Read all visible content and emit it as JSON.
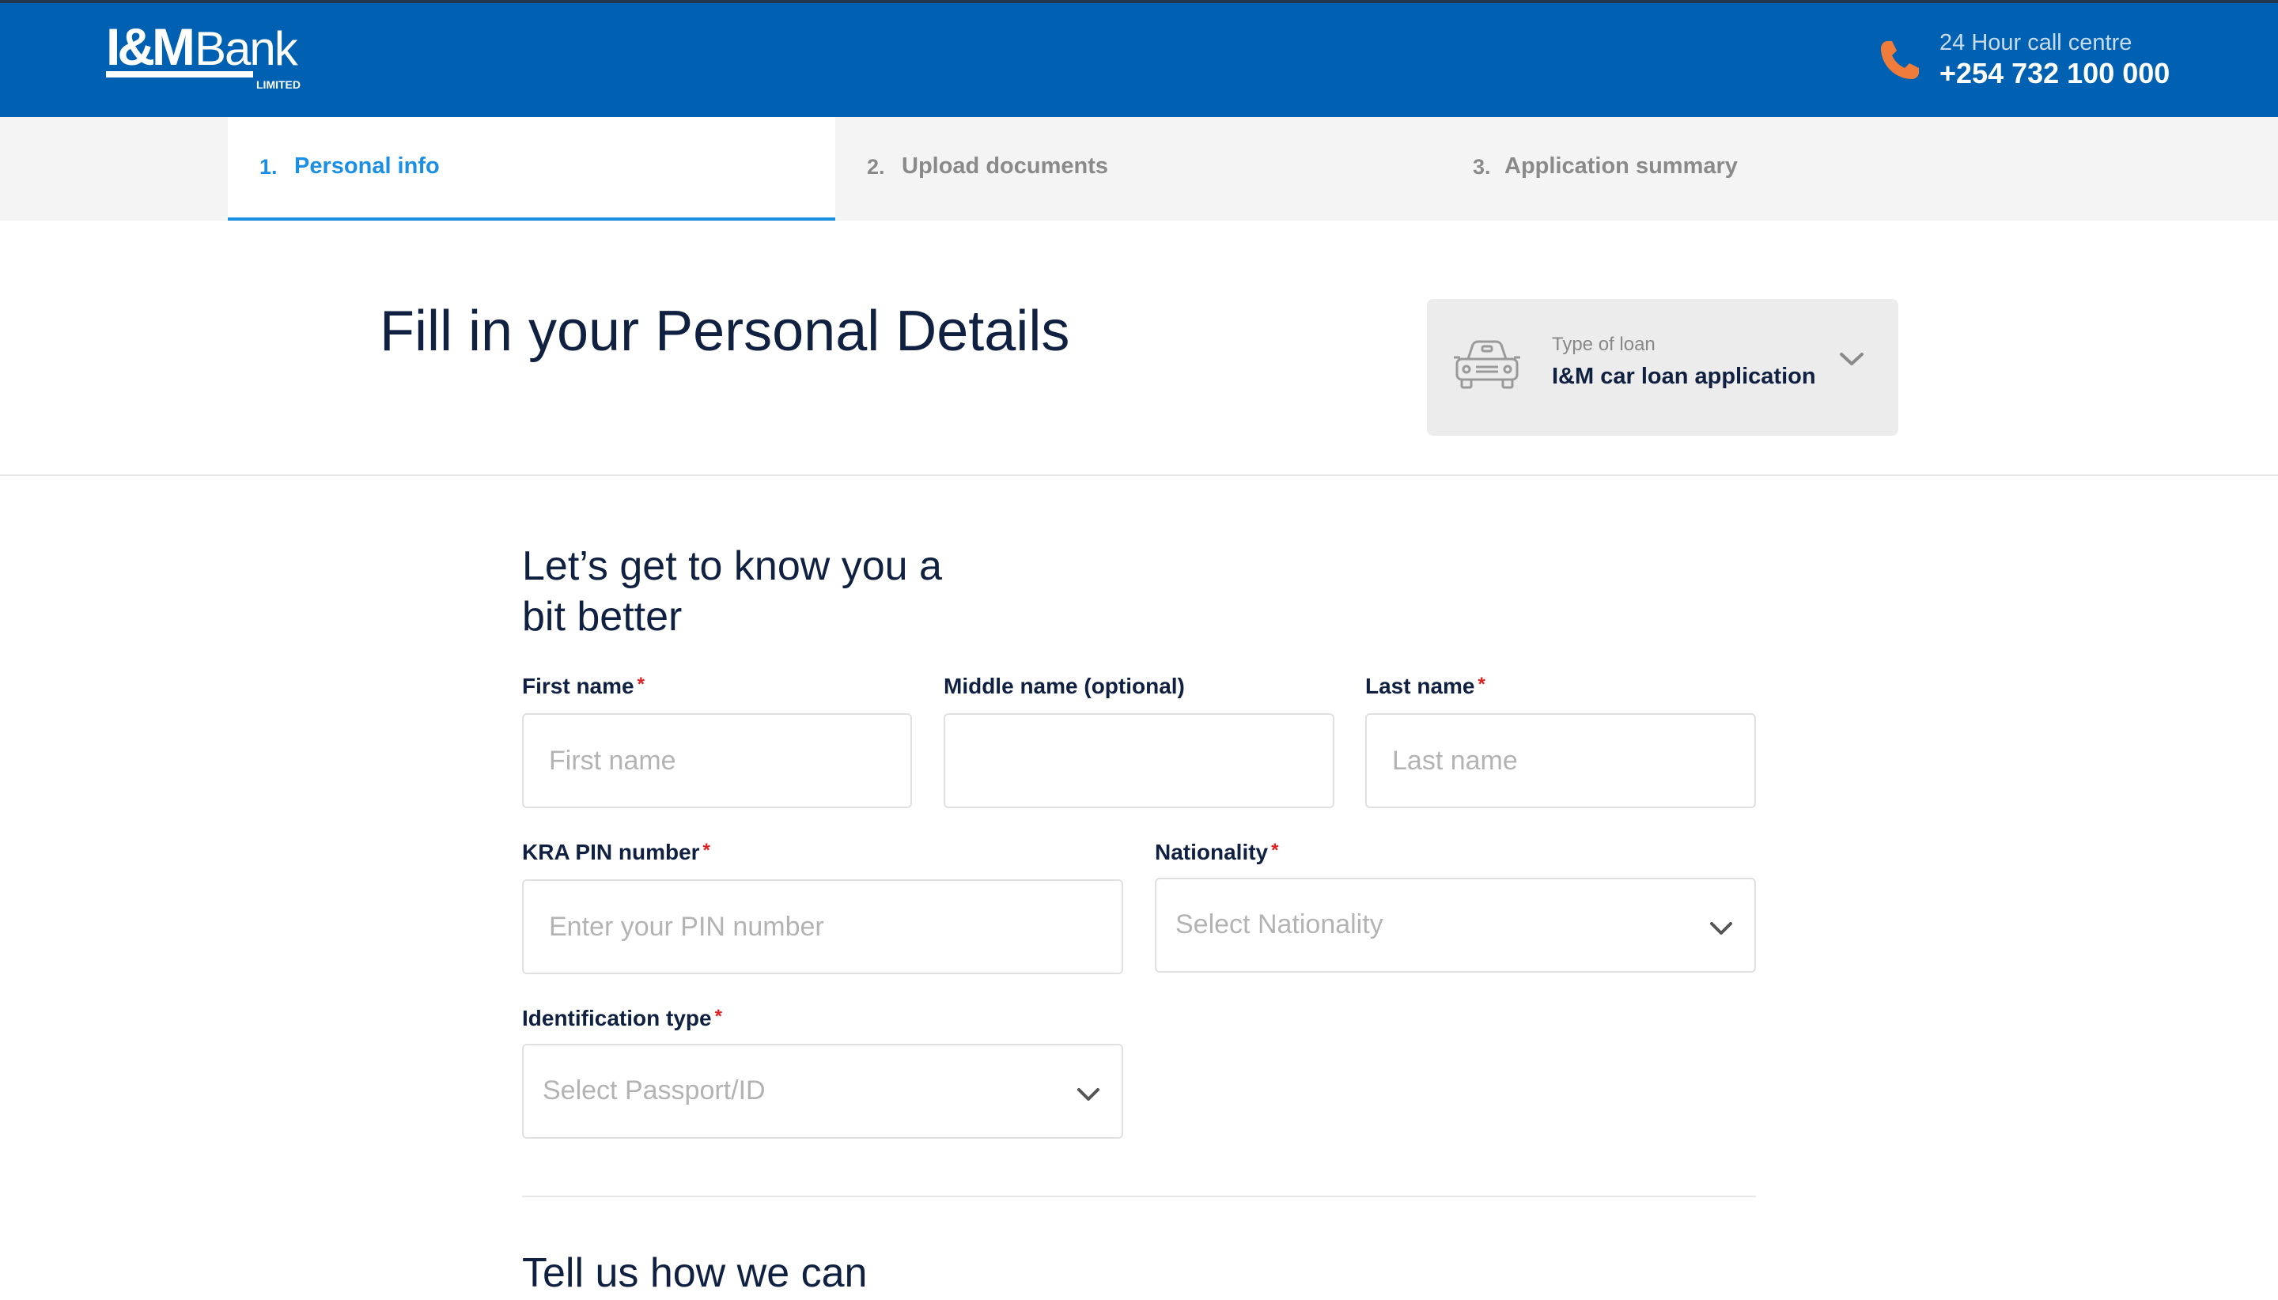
{
  "brand": {
    "logo_text": "I&MBank",
    "logo_subtext": "LIMITED",
    "color": "#0060b1"
  },
  "header": {
    "call_label": "24 Hour call centre",
    "call_number": "+254 732 100 000",
    "call_icon": "phone-icon",
    "call_icon_color": "#f07c3c"
  },
  "steps": [
    {
      "num": "1.",
      "label": "Personal info",
      "active": true
    },
    {
      "num": "2.",
      "label": "Upload documents",
      "active": false
    },
    {
      "num": "3.",
      "label": "Application summary",
      "active": false
    }
  ],
  "page": {
    "title": "Fill in your Personal Details"
  },
  "loan_selector": {
    "label": "Type of loan",
    "value": "I&M car loan application",
    "icon": "car-icon"
  },
  "section1": {
    "title": "Let’s get to know you a bit better",
    "fields": {
      "first_name": {
        "label": "First name",
        "required": "*",
        "placeholder": "First name",
        "value": ""
      },
      "middle_name": {
        "label": "Middle name (optional)",
        "placeholder": "",
        "value": ""
      },
      "last_name": {
        "label": "Last name",
        "required": "*",
        "placeholder": "Last name",
        "value": ""
      },
      "kra_pin": {
        "label": "KRA PIN number",
        "required": "*",
        "placeholder": "Enter your PIN number",
        "value": ""
      },
      "nationality": {
        "label": "Nationality",
        "required": "*",
        "placeholder": "Select Nationality"
      },
      "id_type": {
        "label": "Identification type",
        "required": "*",
        "placeholder": "Select Passport/ID"
      }
    }
  },
  "section2": {
    "title": "Tell us how we can"
  }
}
